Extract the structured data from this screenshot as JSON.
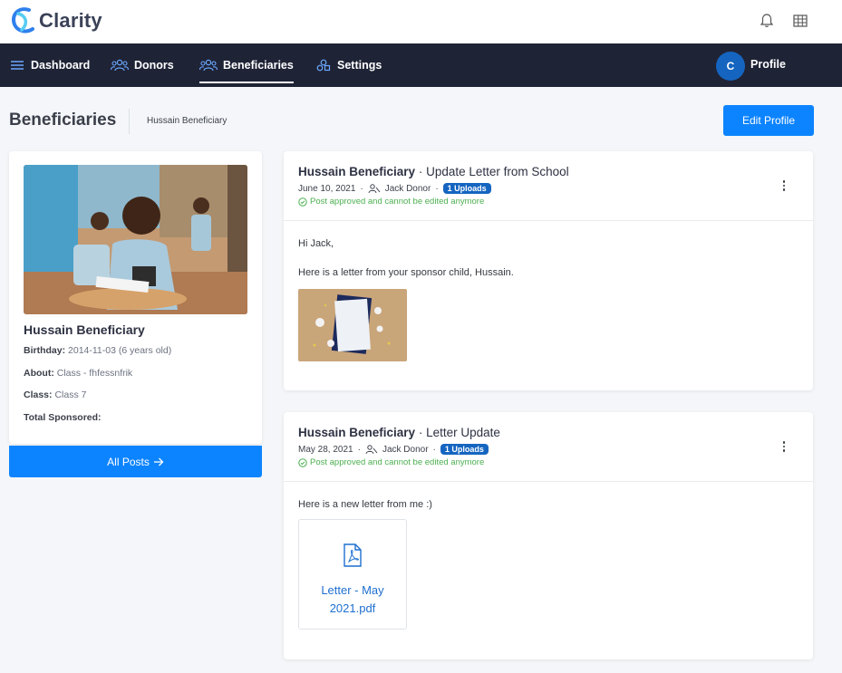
{
  "app": {
    "name": "Clarity"
  },
  "nav": {
    "items": [
      {
        "label": "Dashboard",
        "icon": "menu-icon"
      },
      {
        "label": "Donors",
        "icon": "users-icon"
      },
      {
        "label": "Beneficiaries",
        "icon": "users-icon",
        "active": true
      },
      {
        "label": "Settings",
        "icon": "shapes-icon"
      }
    ],
    "profile": {
      "initial": "C",
      "label": "Profile"
    }
  },
  "page": {
    "title": "Beneficiaries",
    "breadcrumb": "Hussain Beneficiary",
    "edit_label": "Edit Profile"
  },
  "beneficiary": {
    "name": "Hussain Beneficiary",
    "birthday_label": "Birthday:",
    "birthday": "2014-11-03 (6 years old)",
    "about_label": "About:",
    "about": "Class - fhfessnfrik",
    "class_label": "Class:",
    "class": "Class 7",
    "sponsored_label": "Total Sponsored:",
    "sponsored": "",
    "all_posts_label": "All Posts"
  },
  "posts": [
    {
      "author": "Hussain Beneficiary",
      "title": "Update Letter from School",
      "date": "June 10, 2021",
      "donor": "Jack Donor",
      "uploads": "1 Uploads",
      "status": "Post approved and cannot be edited anymore",
      "greeting": "Hi Jack,",
      "body": "Here is a letter from your sponsor child, Hussain."
    },
    {
      "author": "Hussain Beneficiary",
      "title": "Letter Update",
      "date": "May 28, 2021",
      "donor": "Jack Donor",
      "uploads": "1 Uploads",
      "status": "Post approved and cannot be edited anymore",
      "body": "Here is a new letter from me :)",
      "file_line1": "Letter - May",
      "file_line2": "2021.pdf"
    }
  ],
  "colors": {
    "primary": "#0d84ff",
    "nav_bg": "#1f2336",
    "badge": "#1565c0",
    "approved": "#4caf50"
  }
}
